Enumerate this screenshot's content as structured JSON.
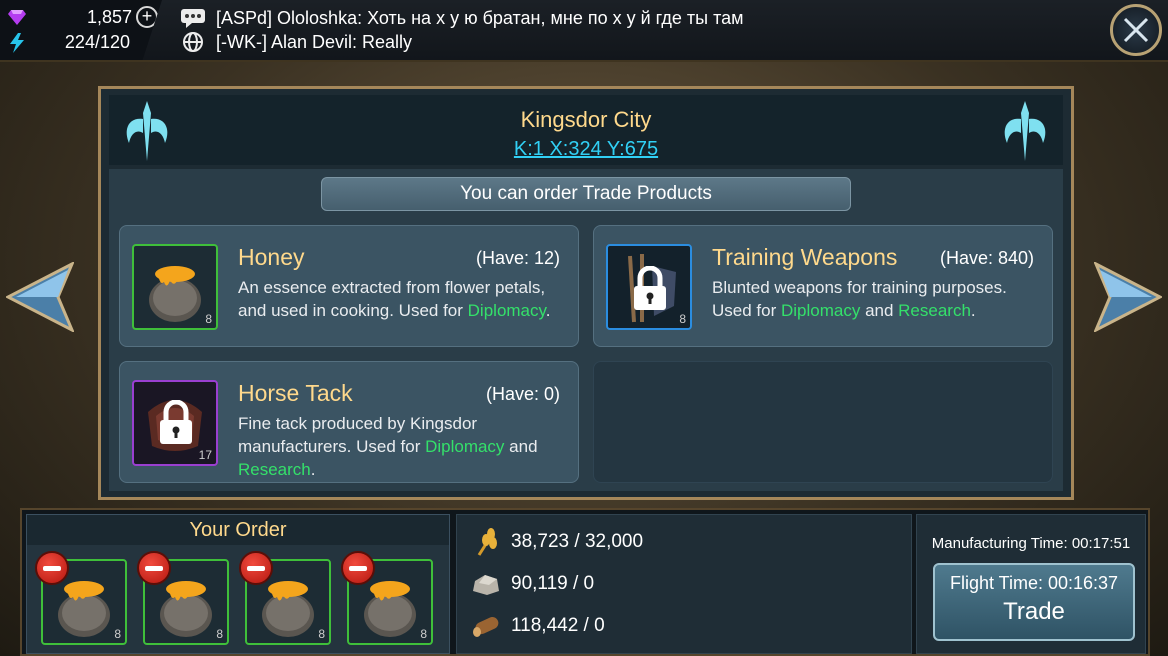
{
  "resources": {
    "gems": "1,857",
    "energy": "224/120"
  },
  "chat": [
    {
      "text": "[ASPd] Ololoshka: Хоть на х у ю братан, мне по х у й где ты там",
      "icon": "speech-bubble-icon"
    },
    {
      "text": "[-WK-] Alan Devil: Really",
      "icon": "globe-icon"
    }
  ],
  "city": {
    "name": "Kingsdor City",
    "coords": "K:1 X:324 Y:675"
  },
  "banner": "You can order Trade Products",
  "products": [
    {
      "title": "Honey",
      "have": "(Have: 12)",
      "level": "8",
      "desc_plain": "An essence extracted from flower petals, and used in cooking. Used for ",
      "desc_links": [
        "Diplomacy"
      ],
      "desc_end": ".",
      "locked": false
    },
    {
      "title": "Training Weapons",
      "have": "(Have: 840)",
      "level": "8",
      "desc_plain": "Blunted weapons for training purposes. Used for ",
      "desc_links": [
        "Diplomacy",
        "Research"
      ],
      "desc_join": " and ",
      "desc_end": ".",
      "locked": true
    },
    {
      "title": "Horse Tack",
      "have": "(Have: 0)",
      "level": "17",
      "desc_plain": "Fine tack produced by Kingsdor manufacturers. Used for ",
      "desc_links": [
        "Diplomacy",
        "Research"
      ],
      "desc_join": " and ",
      "desc_end": ".",
      "locked": true
    }
  ],
  "order": {
    "title": "Your Order",
    "slots": [
      {
        "level": "8"
      },
      {
        "level": "8"
      },
      {
        "level": "8"
      },
      {
        "level": "8"
      }
    ]
  },
  "costs": [
    {
      "icon": "wheat-icon",
      "value": "38,723 / 32,000"
    },
    {
      "icon": "stone-icon",
      "value": "90,119 / 0"
    },
    {
      "icon": "wood-log-icon",
      "value": "118,442 / 0"
    }
  ],
  "trade": {
    "manufacturing_time": "Manufacturing Time: 00:17:51",
    "flight_time": "Flight Time: 00:16:37",
    "button_label": "Trade"
  },
  "colors": {
    "title_gold": "#ffd98c",
    "link_green": "#34e06a",
    "coords_cyan": "#31d0f5"
  }
}
